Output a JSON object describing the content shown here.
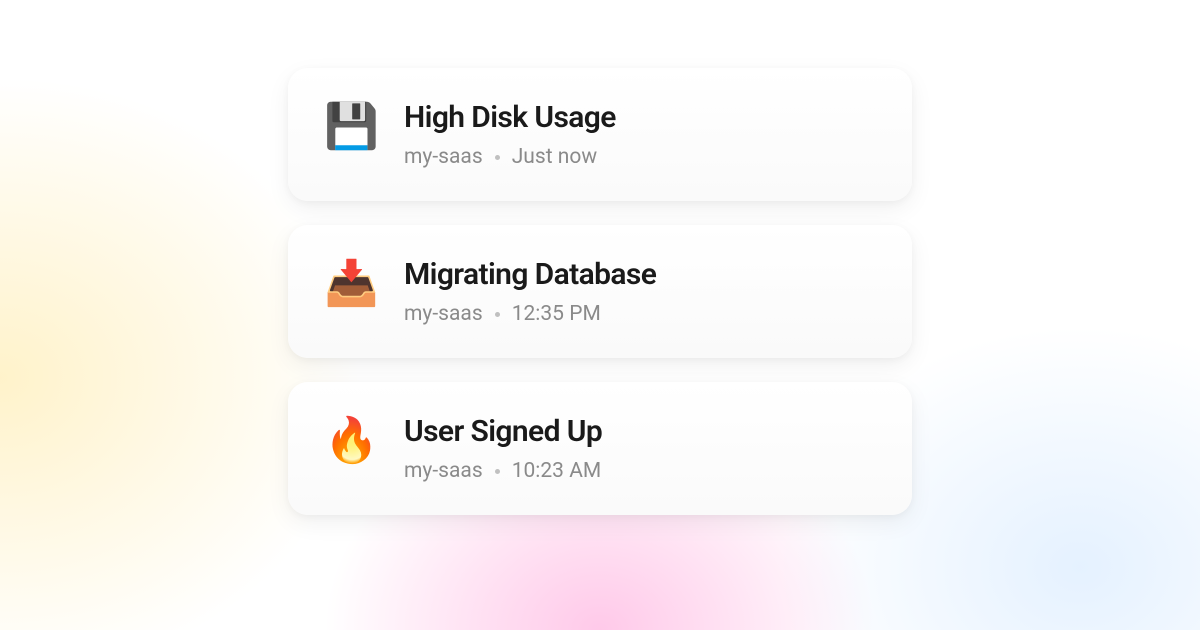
{
  "notifications": [
    {
      "icon": "💾",
      "icon_name": "floppy-disk-icon",
      "title": "High Disk Usage",
      "project": "my-saas",
      "time": "Just now"
    },
    {
      "icon": "📥",
      "icon_name": "inbox-tray-icon",
      "title": "Migrating Database",
      "project": "my-saas",
      "time": "12:35 PM"
    },
    {
      "icon": "🔥",
      "icon_name": "fire-icon",
      "title": "User Signed Up",
      "project": "my-saas",
      "time": "10:23 AM"
    }
  ]
}
